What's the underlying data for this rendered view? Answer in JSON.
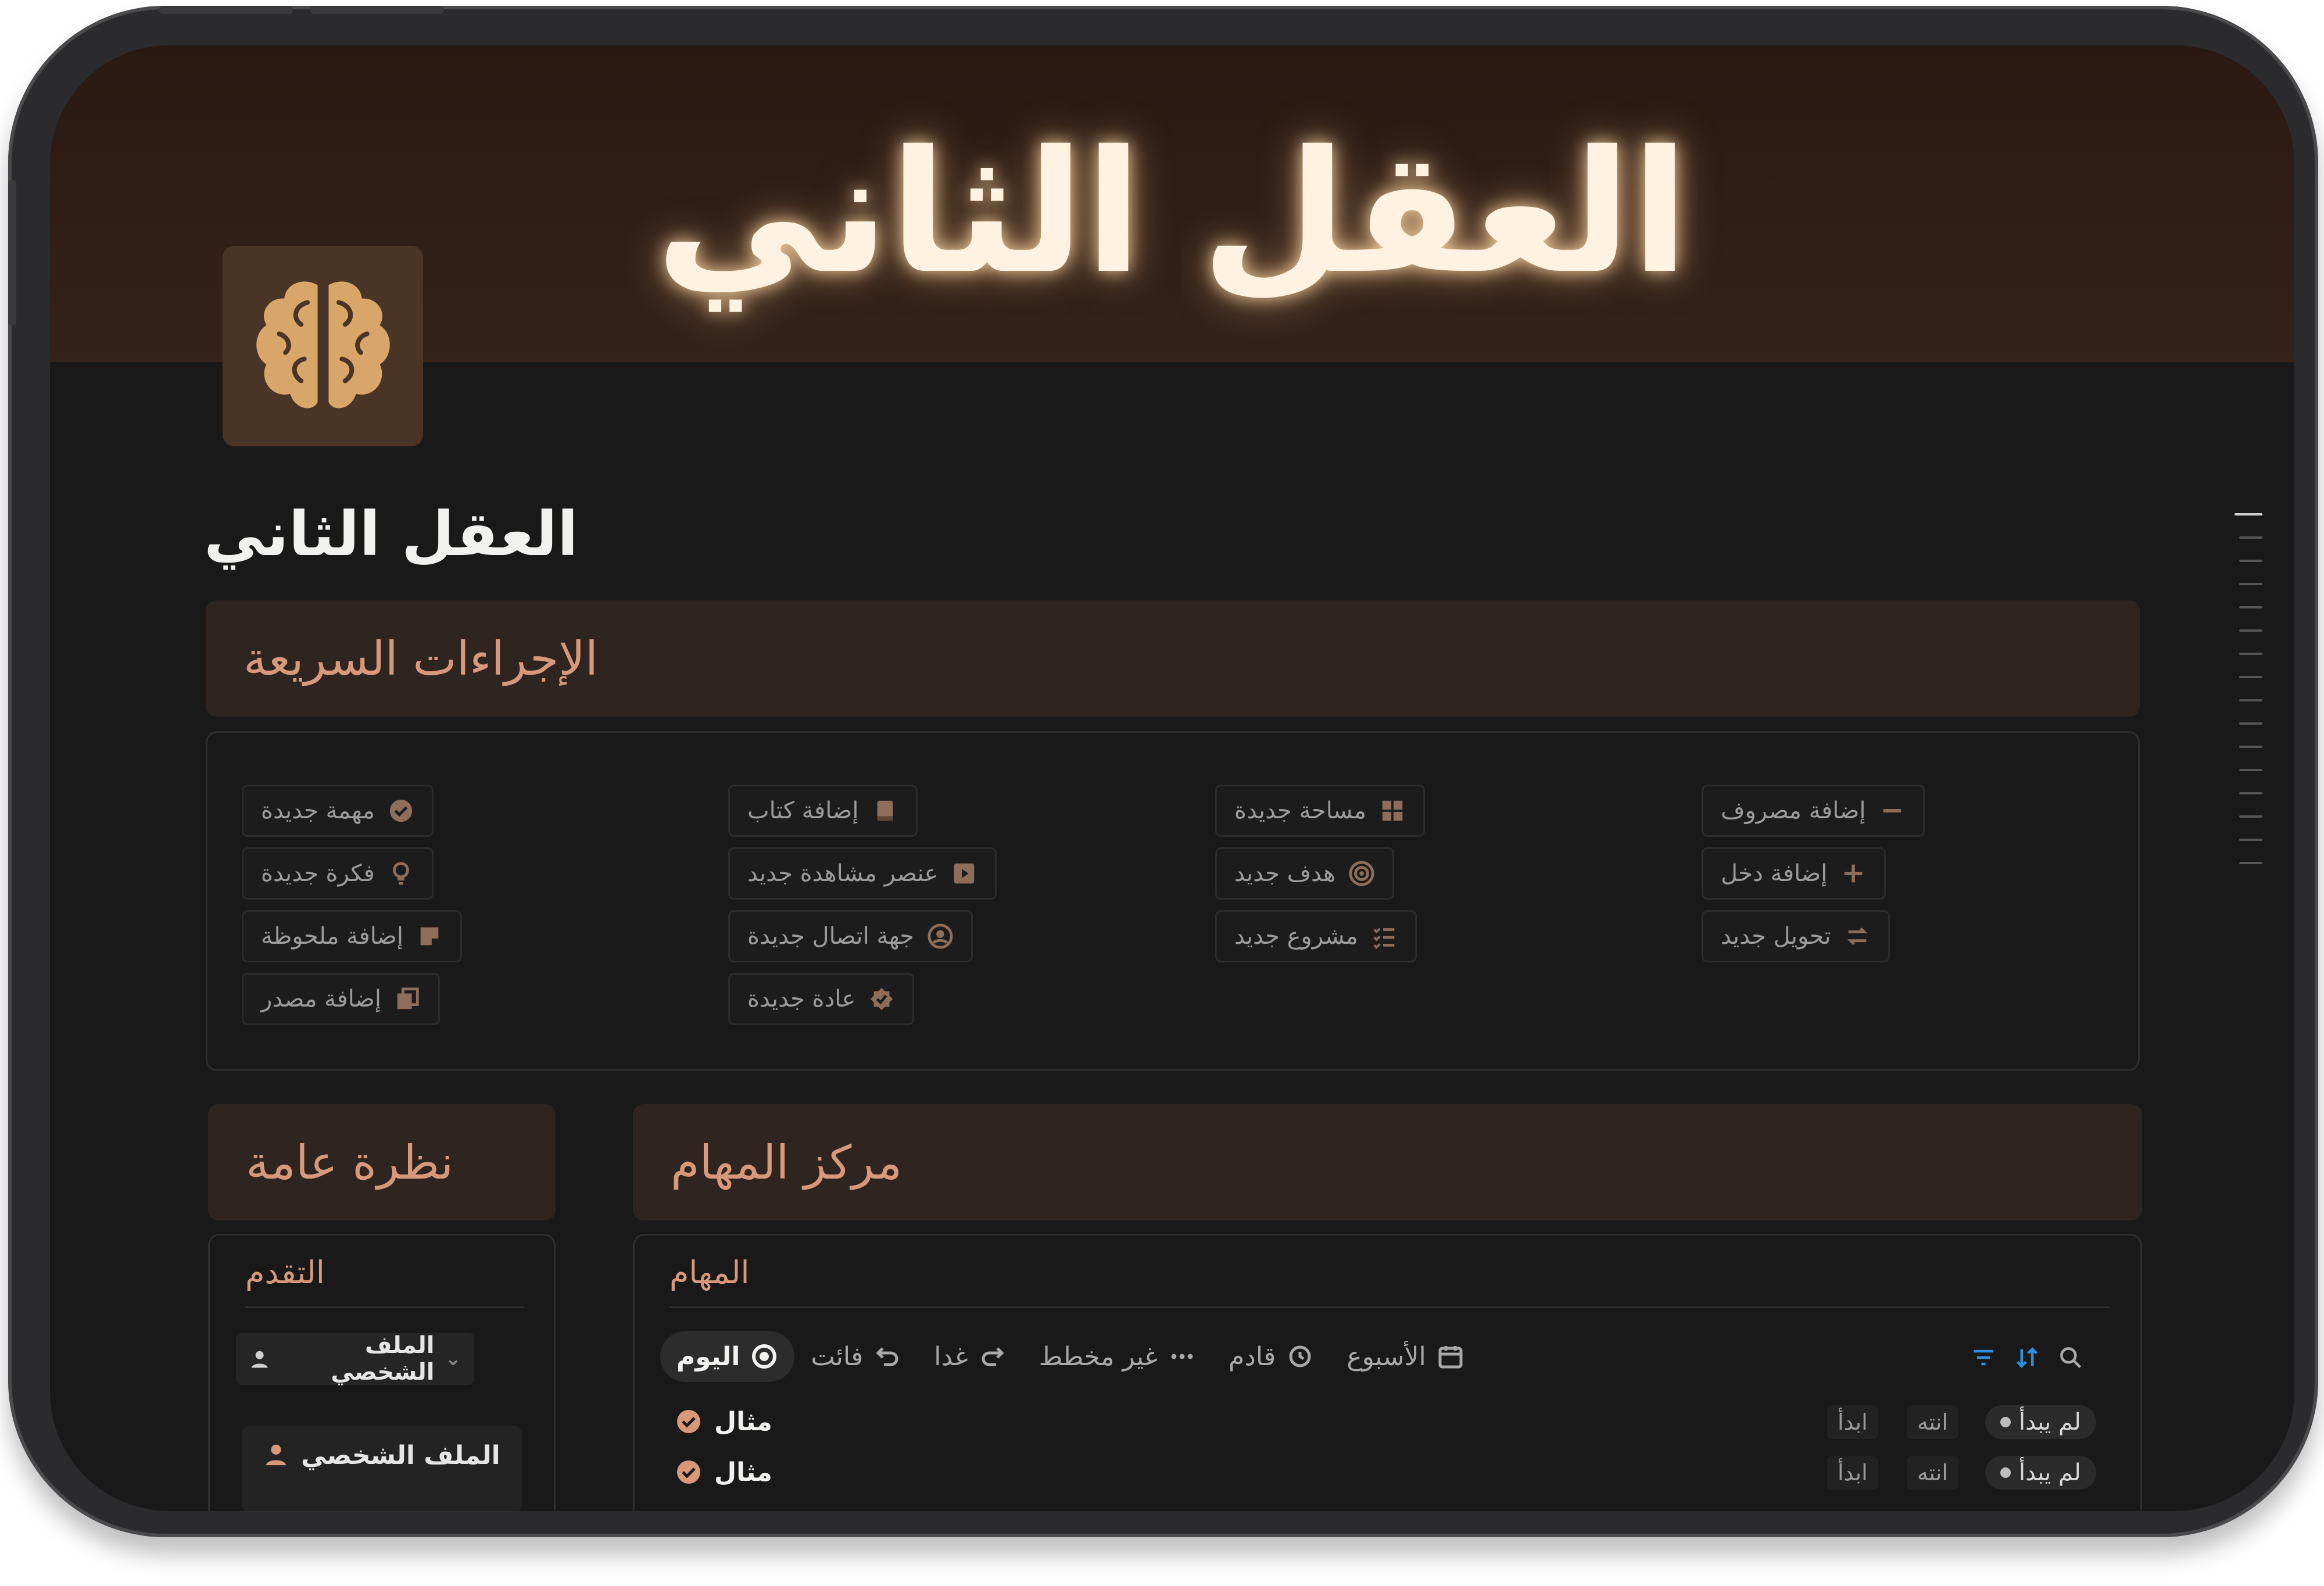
{
  "cover": {
    "title": "العقل الثاني"
  },
  "page": {
    "title": "العقل الثاني"
  },
  "quick_actions": {
    "header": "الإجراءات السريعة",
    "col1": [
      "مهمة جديدة",
      "فكرة جديدة",
      "إضافة ملحوظة",
      "إضافة مصدر"
    ],
    "col2": [
      "إضافة كتاب",
      "عنصر مشاهدة جديد",
      "جهة اتصال جديدة",
      "عادة جديدة"
    ],
    "col3": [
      "مساحة جديدة",
      "هدف جديد",
      "مشروع جديد"
    ],
    "col4": [
      "إضافة مصروف",
      "إضافة دخل",
      "تحويل جديد"
    ]
  },
  "overview": {
    "header": "نظرة عامة",
    "progress_label": "التقدم",
    "profile_select": "الملف الشخصي",
    "profile_card": "الملف الشخصي"
  },
  "task_center": {
    "header": "مركز المهام",
    "tasks_label": "المهام",
    "tabs": [
      "اليوم",
      "فائت",
      "غدا",
      "غير مخطط",
      "قادم",
      "الأسبوع"
    ],
    "rows": [
      {
        "title": "مثال",
        "status": "لم يبدأ",
        "end": "انته",
        "start": "ابدأ"
      },
      {
        "title": "مثال",
        "status": "لم يبدأ",
        "end": "انته",
        "start": "ابدأ"
      }
    ]
  },
  "colors": {
    "accent": "#d8987a",
    "background": "#191919",
    "cover": "#2a1912",
    "brain": "#d9a66a"
  }
}
